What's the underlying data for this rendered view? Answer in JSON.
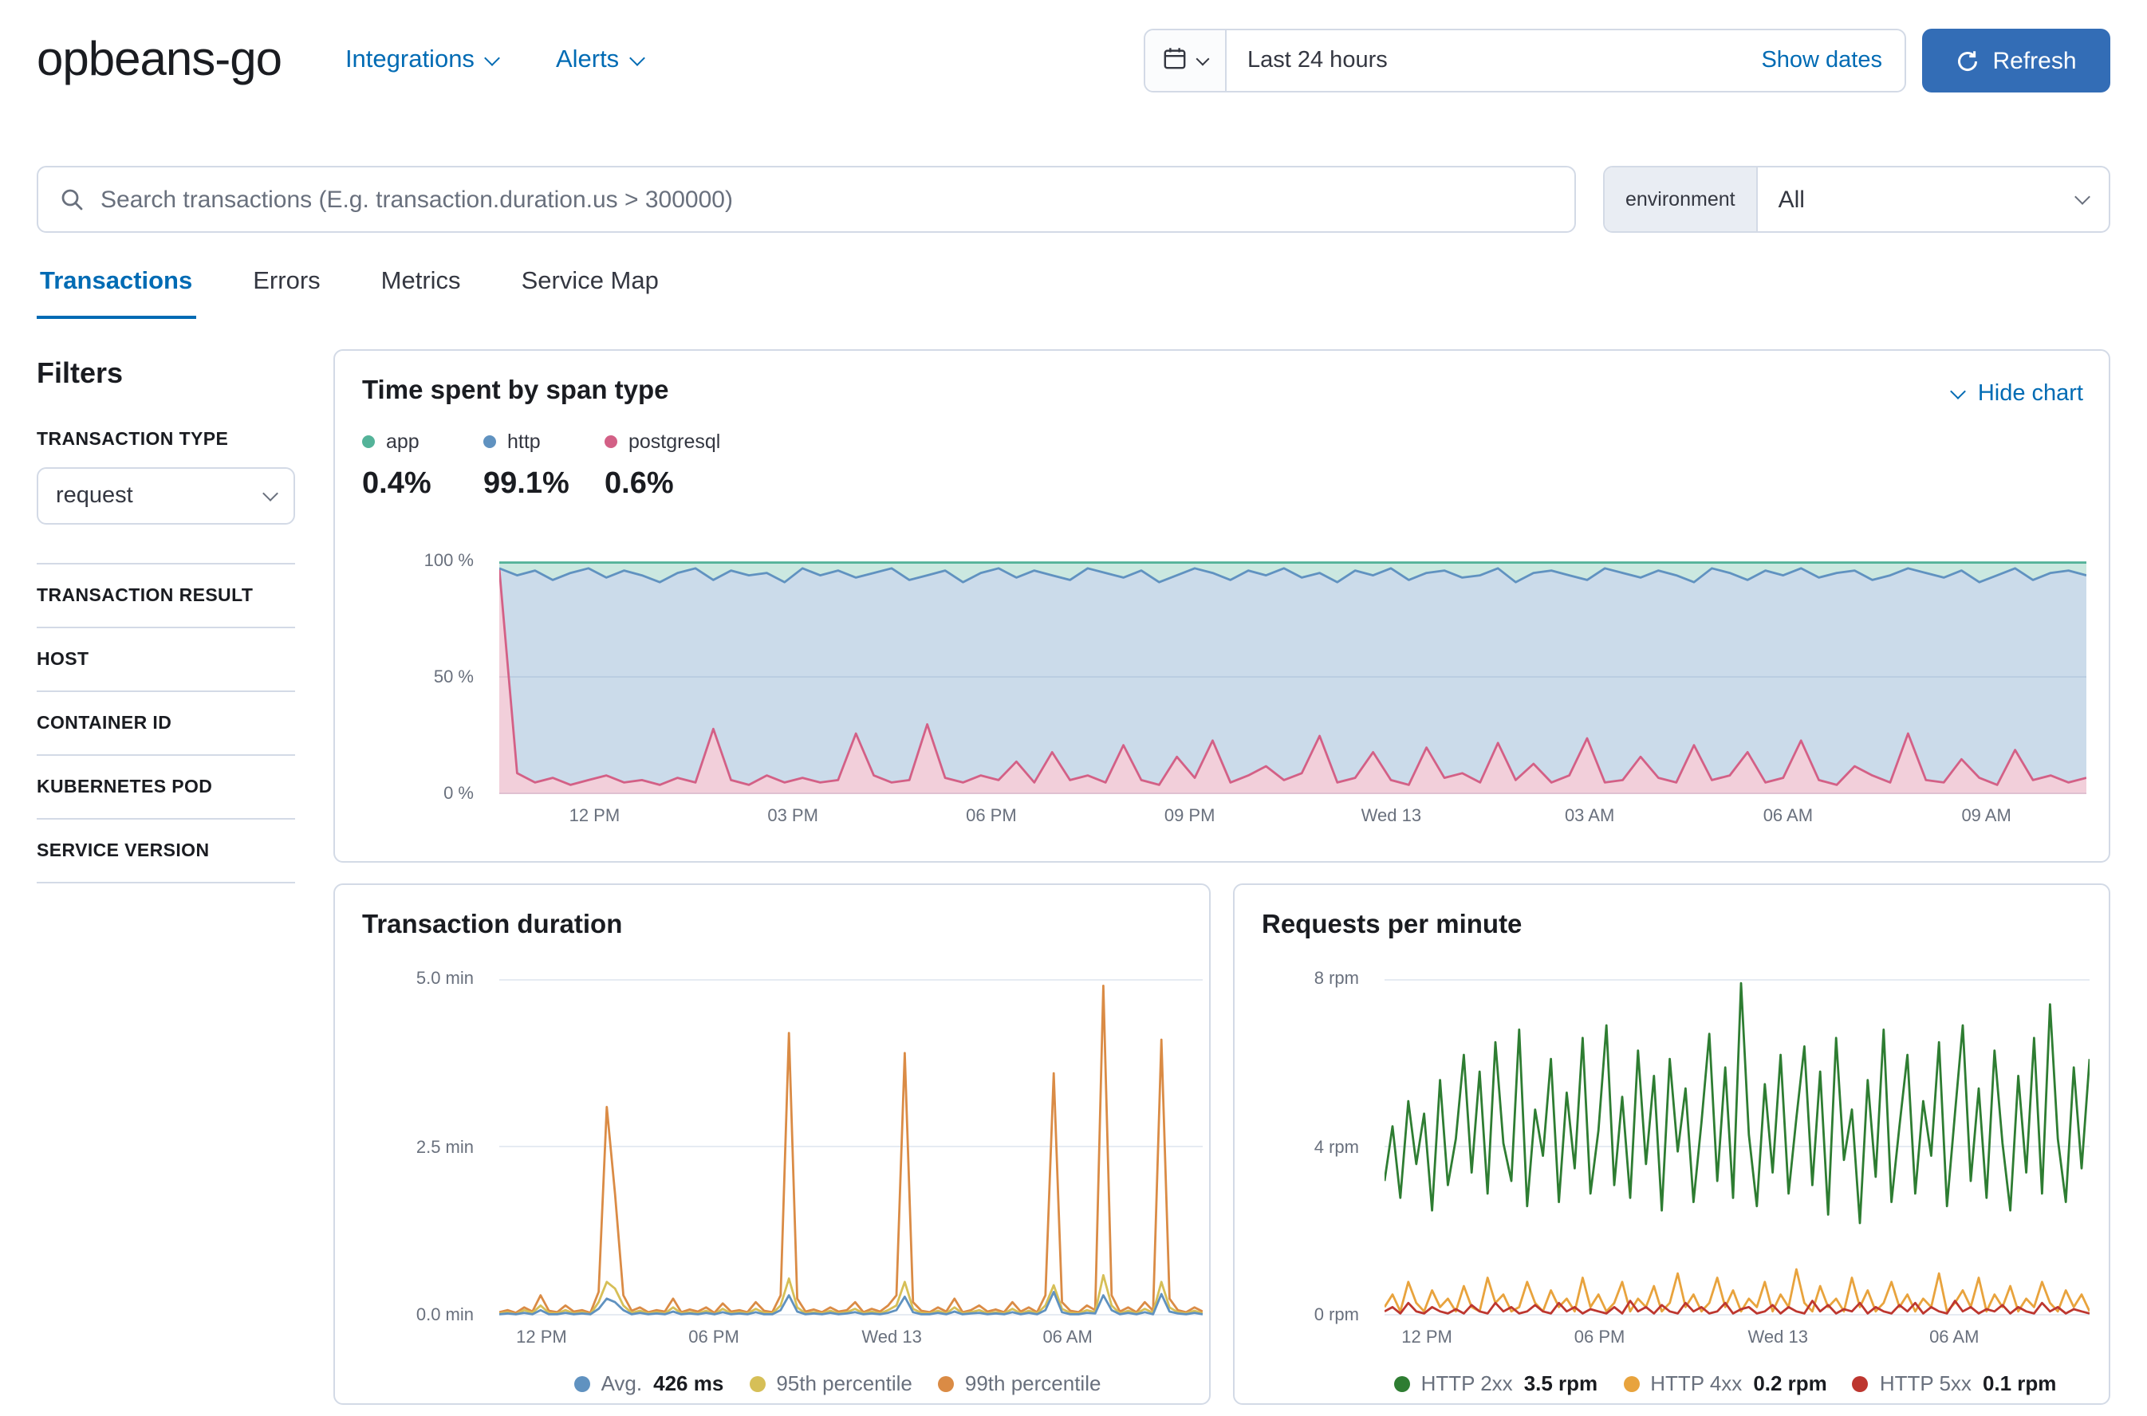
{
  "header": {
    "service_name": "opbeans-go",
    "nav": [
      {
        "label": "Integrations"
      },
      {
        "label": "Alerts"
      }
    ],
    "datepicker": {
      "value": "Last 24 hours",
      "show_dates_label": "Show dates"
    },
    "refresh_label": "Refresh"
  },
  "search": {
    "placeholder": "Search transactions (E.g. transaction.duration.us > 300000)",
    "environment_label": "environment",
    "environment_value": "All"
  },
  "tabs": [
    {
      "label": "Transactions",
      "active": true
    },
    {
      "label": "Errors",
      "active": false
    },
    {
      "label": "Metrics",
      "active": false
    },
    {
      "label": "Service Map",
      "active": false
    }
  ],
  "filters": {
    "title": "Filters",
    "transaction_type_label": "TRANSACTION TYPE",
    "transaction_type_value": "request",
    "sections": [
      "TRANSACTION RESULT",
      "HOST",
      "CONTAINER ID",
      "KUBERNETES POD",
      "SERVICE VERSION"
    ]
  },
  "span_panel": {
    "hide_chart_label": "Hide chart"
  },
  "chart_data": [
    {
      "id": "span-type",
      "type": "area_stacked_percent",
      "title": "Time spent by span type",
      "grid": true,
      "legend_position": "top",
      "y_ticks": [
        "100 %",
        "50 %",
        "0 %"
      ],
      "y_range": [
        0,
        100
      ],
      "x_ticks": [
        {
          "label": "12 PM",
          "pos": 0.06
        },
        {
          "label": "03 PM",
          "pos": 0.185
        },
        {
          "label": "06 PM",
          "pos": 0.31
        },
        {
          "label": "09 PM",
          "pos": 0.435
        },
        {
          "label": "Wed 13",
          "pos": 0.562
        },
        {
          "label": "03 AM",
          "pos": 0.687
        },
        {
          "label": "06 AM",
          "pos": 0.812
        },
        {
          "label": "09 AM",
          "pos": 0.937
        }
      ],
      "series": [
        {
          "name": "app",
          "color": "#54b399",
          "pct": "0.4%",
          "values": [
            3,
            6,
            4,
            8,
            5,
            3,
            7,
            4,
            6,
            9,
            5,
            3,
            8,
            4,
            6,
            5,
            9,
            3,
            6,
            4,
            7,
            5,
            3,
            8,
            6,
            4,
            9,
            5,
            3,
            7,
            4,
            6,
            8,
            3,
            5,
            7,
            4,
            9,
            6,
            3,
            5,
            8,
            4,
            6,
            3,
            7,
            5,
            9,
            4,
            6,
            3,
            8,
            5,
            4,
            7,
            6,
            3,
            9,
            5,
            4,
            6,
            8,
            3,
            5,
            7,
            4,
            6,
            9,
            3,
            5,
            8,
            4,
            6,
            3,
            7,
            5,
            4,
            8,
            6,
            3,
            5,
            7,
            4,
            9,
            6,
            3,
            8,
            5,
            4,
            6
          ]
        },
        {
          "name": "http",
          "color": "#6092c0",
          "pct": "99.1%",
          "values": "remainder"
        },
        {
          "name": "postgresql",
          "color": "#d36086",
          "pct": "0.6%",
          "values": [
            97,
            9,
            5,
            7,
            4,
            6,
            8,
            5,
            6,
            4,
            7,
            5,
            28,
            6,
            4,
            8,
            5,
            7,
            5,
            6,
            26,
            8,
            5,
            6,
            30,
            7,
            5,
            8,
            6,
            14,
            5,
            18,
            6,
            8,
            5,
            21,
            6,
            4,
            16,
            7,
            23,
            5,
            8,
            12,
            6,
            9,
            25,
            5,
            7,
            18,
            6,
            4,
            20,
            7,
            9,
            5,
            22,
            6,
            13,
            5,
            8,
            24,
            5,
            6,
            16,
            7,
            5,
            21,
            6,
            8,
            18,
            5,
            7,
            23,
            6,
            4,
            12,
            8,
            5,
            26,
            6,
            5,
            15,
            7,
            4,
            19,
            6,
            8,
            5,
            7
          ]
        }
      ]
    },
    {
      "id": "transaction-duration",
      "type": "line",
      "title": "Transaction duration",
      "grid": true,
      "legend_position": "bottom",
      "draw_reversed": true,
      "y_max": 5.0,
      "y_ticks": [
        "5.0 min",
        "2.5 min",
        "0.0 min"
      ],
      "x_ticks": [
        {
          "label": "12 PM",
          "pos": 0.06
        },
        {
          "label": "06 PM",
          "pos": 0.305
        },
        {
          "label": "Wed 13",
          "pos": 0.558
        },
        {
          "label": "06 AM",
          "pos": 0.808
        }
      ],
      "series": [
        {
          "name": "Avg.",
          "value_label": "426 ms",
          "color": "#6092c0",
          "values": [
            0.02,
            0.03,
            0.02,
            0.04,
            0.02,
            0.08,
            0.02,
            0.02,
            0.04,
            0.02,
            0.03,
            0.02,
            0.1,
            0.25,
            0.2,
            0.08,
            0.02,
            0.04,
            0.02,
            0.03,
            0.02,
            0.06,
            0.02,
            0.03,
            0.02,
            0.04,
            0.02,
            0.05,
            0.02,
            0.03,
            0.02,
            0.05,
            0.02,
            0.02,
            0.08,
            0.3,
            0.06,
            0.02,
            0.03,
            0.02,
            0.04,
            0.02,
            0.03,
            0.05,
            0.02,
            0.03,
            0.02,
            0.04,
            0.08,
            0.28,
            0.05,
            0.02,
            0.02,
            0.04,
            0.02,
            0.06,
            0.02,
            0.03,
            0.04,
            0.02,
            0.03,
            0.02,
            0.05,
            0.02,
            0.04,
            0.02,
            0.08,
            0.35,
            0.05,
            0.02,
            0.02,
            0.04,
            0.03,
            0.3,
            0.08,
            0.02,
            0.04,
            0.02,
            0.05,
            0.02,
            0.32,
            0.06,
            0.03,
            0.02,
            0.04,
            0.02
          ]
        },
        {
          "name": "95th percentile",
          "color": "#d6bf57",
          "values": [
            0.03,
            0.05,
            0.02,
            0.08,
            0.04,
            0.15,
            0.04,
            0.03,
            0.08,
            0.03,
            0.05,
            0.02,
            0.2,
            0.5,
            0.4,
            0.15,
            0.04,
            0.07,
            0.03,
            0.05,
            0.03,
            0.12,
            0.03,
            0.05,
            0.03,
            0.07,
            0.02,
            0.1,
            0.03,
            0.05,
            0.03,
            0.1,
            0.04,
            0.03,
            0.15,
            0.55,
            0.12,
            0.03,
            0.05,
            0.03,
            0.07,
            0.03,
            0.05,
            0.1,
            0.03,
            0.06,
            0.03,
            0.08,
            0.15,
            0.5,
            0.1,
            0.04,
            0.03,
            0.07,
            0.03,
            0.12,
            0.03,
            0.05,
            0.08,
            0.03,
            0.05,
            0.03,
            0.1,
            0.03,
            0.07,
            0.03,
            0.15,
            0.45,
            0.1,
            0.04,
            0.03,
            0.08,
            0.05,
            0.6,
            0.15,
            0.03,
            0.07,
            0.03,
            0.1,
            0.04,
            0.5,
            0.12,
            0.05,
            0.03,
            0.07,
            0.03
          ]
        },
        {
          "name": "99th percentile",
          "color": "#da8b45",
          "values": [
            0.05,
            0.08,
            0.04,
            0.12,
            0.06,
            0.3,
            0.07,
            0.05,
            0.15,
            0.06,
            0.08,
            0.04,
            0.35,
            3.1,
            1.8,
            0.3,
            0.07,
            0.12,
            0.05,
            0.08,
            0.06,
            0.25,
            0.05,
            0.09,
            0.06,
            0.12,
            0.04,
            0.18,
            0.06,
            0.08,
            0.05,
            0.2,
            0.07,
            0.05,
            0.3,
            4.2,
            0.25,
            0.06,
            0.09,
            0.05,
            0.12,
            0.06,
            0.08,
            0.2,
            0.05,
            0.1,
            0.06,
            0.15,
            0.3,
            3.9,
            0.2,
            0.07,
            0.05,
            0.12,
            0.06,
            0.25,
            0.05,
            0.08,
            0.15,
            0.06,
            0.09,
            0.05,
            0.2,
            0.06,
            0.12,
            0.05,
            0.3,
            3.6,
            0.2,
            0.07,
            0.05,
            0.15,
            0.08,
            4.9,
            0.3,
            0.06,
            0.12,
            0.05,
            0.2,
            0.07,
            4.1,
            0.25,
            0.08,
            0.05,
            0.12,
            0.06
          ]
        }
      ]
    },
    {
      "id": "requests-per-minute",
      "type": "line",
      "title": "Requests per minute",
      "grid": true,
      "legend_position": "bottom",
      "y_max": 8,
      "y_ticks": [
        "8 rpm",
        "4 rpm",
        "0 rpm"
      ],
      "x_ticks": [
        {
          "label": "12 PM",
          "pos": 0.06
        },
        {
          "label": "06 PM",
          "pos": 0.305
        },
        {
          "label": "Wed 13",
          "pos": 0.558
        },
        {
          "label": "06 AM",
          "pos": 0.808
        }
      ],
      "series": [
        {
          "name": "HTTP 2xx",
          "value_label": "3.5 rpm",
          "color": "#2e7d32",
          "values": [
            3.2,
            4.5,
            2.8,
            5.1,
            3.6,
            4.8,
            2.5,
            5.6,
            3.1,
            4.2,
            6.2,
            3.4,
            5.8,
            2.9,
            6.5,
            4.1,
            3.2,
            6.8,
            2.6,
            4.9,
            3.8,
            6.1,
            2.7,
            5.3,
            3.5,
            6.6,
            2.9,
            4.4,
            6.9,
            3.1,
            5.2,
            2.8,
            6.3,
            3.6,
            5.7,
            2.5,
            6.1,
            3.9,
            5.4,
            2.7,
            4.6,
            6.7,
            3.2,
            5.9,
            2.8,
            7.9,
            4.3,
            2.6,
            5.5,
            3.4,
            6.2,
            2.9,
            4.7,
            6.4,
            3.1,
            5.8,
            2.4,
            6.6,
            3.7,
            4.9,
            2.2,
            5.6,
            3.3,
            6.8,
            2.7,
            4.5,
            6.2,
            2.9,
            5.1,
            3.8,
            6.5,
            2.6,
            4.8,
            6.9,
            3.2,
            5.4,
            2.8,
            6.3,
            4.1,
            2.5,
            5.7,
            3.4,
            6.6,
            2.9,
            7.4,
            4.2,
            2.7,
            5.9,
            3.5,
            6.1
          ]
        },
        {
          "name": "HTTP 4xx",
          "value_label": "0.2 rpm",
          "color": "#e8a33d",
          "values": [
            0.2,
            0.5,
            0.1,
            0.8,
            0.3,
            0.1,
            0.6,
            0.2,
            0.4,
            0.1,
            0.7,
            0.2,
            0.1,
            0.9,
            0.3,
            0.5,
            0.1,
            0.2,
            0.8,
            0.3,
            0.1,
            0.6,
            0.2,
            0.4,
            0.1,
            0.9,
            0.2,
            0.5,
            0.1,
            0.3,
            0.8,
            0.1,
            0.4,
            0.2,
            0.7,
            0.1,
            0.3,
            1.0,
            0.2,
            0.5,
            0.1,
            0.3,
            0.9,
            0.2,
            0.6,
            0.1,
            0.4,
            0.2,
            0.8,
            0.1,
            0.5,
            0.2,
            1.1,
            0.3,
            0.1,
            0.7,
            0.2,
            0.4,
            0.1,
            0.9,
            0.2,
            0.6,
            0.1,
            0.3,
            0.8,
            0.2,
            0.5,
            0.1,
            0.4,
            0.2,
            1.0,
            0.1,
            0.3,
            0.6,
            0.2,
            0.9,
            0.1,
            0.5,
            0.2,
            0.7,
            0.1,
            0.4,
            0.2,
            0.8,
            0.3,
            0.1,
            0.6,
            0.2,
            0.5,
            0.1
          ]
        },
        {
          "name": "HTTP 5xx",
          "value_label": "0.1 rpm",
          "color": "#bd362f",
          "values": [
            0.1,
            0.2,
            0.05,
            0.3,
            0.1,
            0.05,
            0.2,
            0.1,
            0.05,
            0.15,
            0.05,
            0.25,
            0.1,
            0.05,
            0.3,
            0.1,
            0.2,
            0.05,
            0.1,
            0.25,
            0.1,
            0.05,
            0.3,
            0.1,
            0.2,
            0.05,
            0.15,
            0.1,
            0.05,
            0.2,
            0.05,
            0.35,
            0.1,
            0.2,
            0.05,
            0.25,
            0.1,
            0.05,
            0.3,
            0.1,
            0.2,
            0.05,
            0.1,
            0.3,
            0.05,
            0.15,
            0.2,
            0.05,
            0.1,
            0.25,
            0.05,
            0.2,
            0.1,
            0.05,
            0.35,
            0.1,
            0.25,
            0.05,
            0.15,
            0.1,
            0.3,
            0.05,
            0.2,
            0.1,
            0.05,
            0.25,
            0.1,
            0.3,
            0.05,
            0.2,
            0.1,
            0.05,
            0.35,
            0.1,
            0.2,
            0.05,
            0.15,
            0.1,
            0.25,
            0.05,
            0.2,
            0.1,
            0.05,
            0.3,
            0.1,
            0.2,
            0.05,
            0.15,
            0.1,
            0.05
          ]
        }
      ]
    }
  ]
}
